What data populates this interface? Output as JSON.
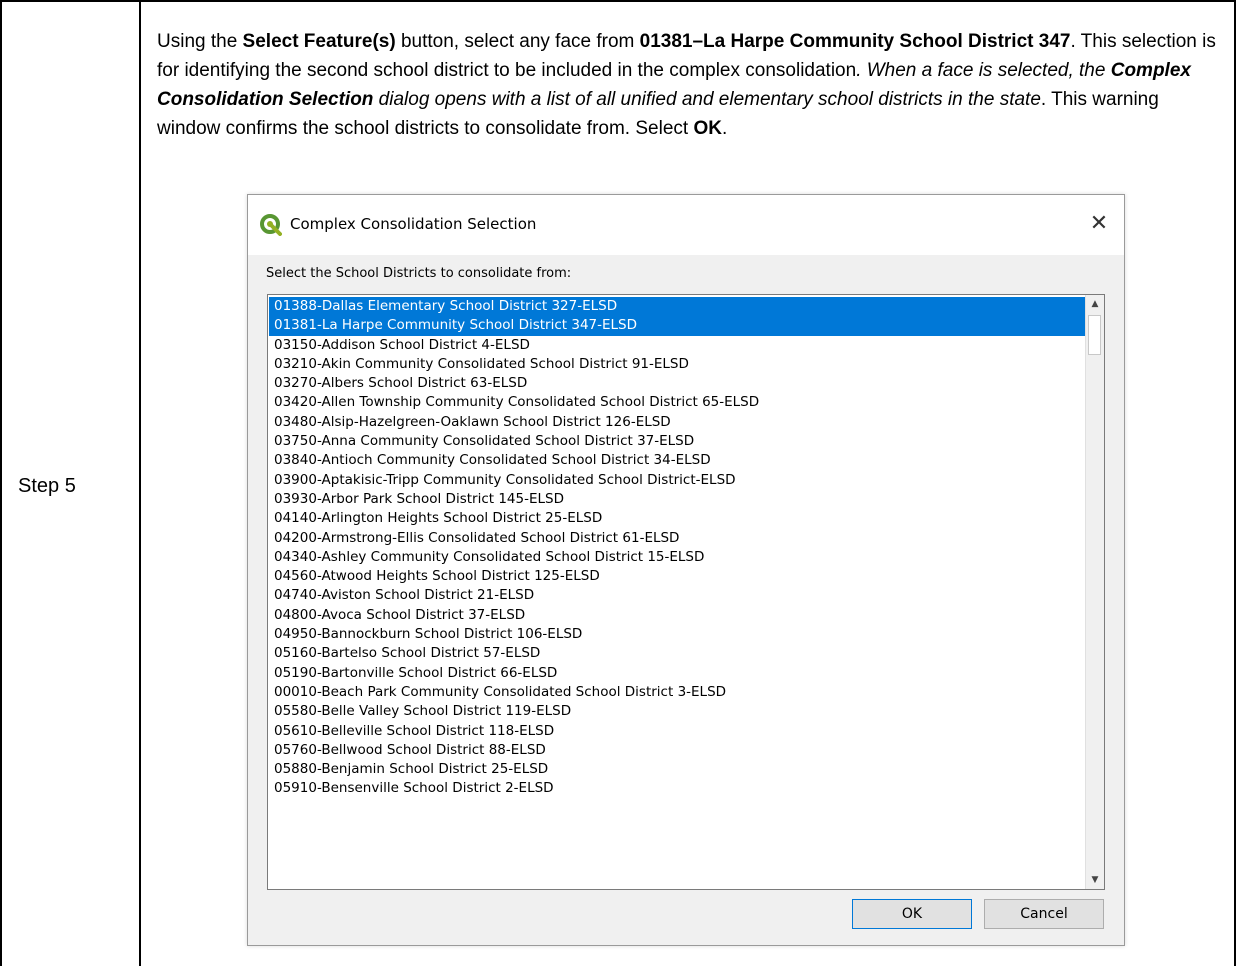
{
  "step_label": "Step 5",
  "instructions": {
    "p1": "Using the ",
    "b1": "Select Feature(s)",
    "p2": " button, select any face from ",
    "b2": "01381–La Harpe Community School District 347",
    "p3": ". This selection is for identifying the second school district to be included in the complex consolidation",
    "i1": ". When a face is selected, the ",
    "bi1": "Complex Consolidation Selection",
    "i2": " dialog opens with a list of all unified and elementary school districts in the state",
    "p4": ". This warning window confirms the school districts to consolidate from. Select ",
    "b3": "OK",
    "p5": "."
  },
  "dialog": {
    "title": "Complex Consolidation Selection",
    "close_glyph": "✕",
    "prompt": "Select the School Districts to consolidate from:",
    "items": [
      "01388-Dallas Elementary School District 327-ELSD",
      "01381-La Harpe Community School District 347-ELSD",
      "03150-Addison School District 4-ELSD",
      "03210-Akin Community Consolidated School District 91-ELSD",
      "03270-Albers School District 63-ELSD",
      "03420-Allen Township Community Consolidated School District 65-ELSD",
      "03480-Alsip-Hazelgreen-Oaklawn School District 126-ELSD",
      "03750-Anna Community Consolidated School District 37-ELSD",
      "03840-Antioch Community Consolidated School District 34-ELSD",
      "03900-Aptakisic-Tripp Community Consolidated School District-ELSD",
      "03930-Arbor Park School District 145-ELSD",
      "04140-Arlington Heights School District 25-ELSD",
      "04200-Armstrong-Ellis Consolidated School District 61-ELSD",
      "04340-Ashley Community Consolidated School District 15-ELSD",
      "04560-Atwood Heights School District 125-ELSD",
      "04740-Aviston School District 21-ELSD",
      "04800-Avoca School District 37-ELSD",
      "04950-Bannockburn School District 106-ELSD",
      "05160-Bartelso School District 57-ELSD",
      "05190-Bartonville School District 66-ELSD",
      "00010-Beach Park Community Consolidated School District 3-ELSD",
      "05580-Belle Valley School District 119-ELSD",
      "05610-Belleville School District 118-ELSD",
      "05760-Bellwood School District 88-ELSD",
      "05880-Benjamin School District 25-ELSD",
      "05910-Bensenville School District 2-ELSD"
    ],
    "selected_indices": [
      0,
      1
    ],
    "ok_label": "OK",
    "cancel_label": "Cancel",
    "selection_color": "#0078d7",
    "icon": "qgis-logo-icon"
  }
}
